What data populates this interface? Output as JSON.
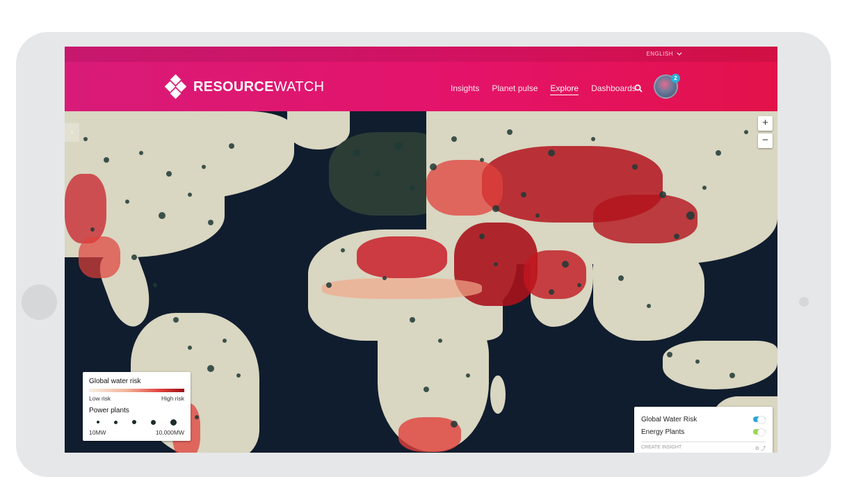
{
  "header": {
    "language": "ENGLISH",
    "logo": {
      "bold": "RESOURCE",
      "light": "WATCH"
    },
    "nav": [
      "Insights",
      "Planet pulse",
      "Explore",
      "Dashboards"
    ],
    "active_nav": "Explore",
    "notification_count": "2"
  },
  "map": {
    "zoom_in": "+",
    "zoom_out": "−",
    "sidebar_toggle": "›"
  },
  "legend": {
    "water_title": "Global water risk",
    "low": "Low risk",
    "high": "High risk",
    "plants_title": "Power plants",
    "min": "10MW",
    "max": "10,000MW"
  },
  "layers": {
    "items": [
      {
        "label": "Global Water Risk",
        "color": "#2aa7d6"
      },
      {
        "label": "Energy Plants",
        "color": "#9ad653"
      }
    ],
    "footer_label": "CREATE INSIGHT"
  },
  "colors": {
    "header_start": "#d81b78",
    "header_end": "#e3124a",
    "land": "#d9d6c1",
    "ocean": "#101d2e",
    "risk_high": "#b3141d",
    "risk_mid": "#e0403b",
    "risk_low": "#f1a88a",
    "plant": "#1f3a36"
  }
}
